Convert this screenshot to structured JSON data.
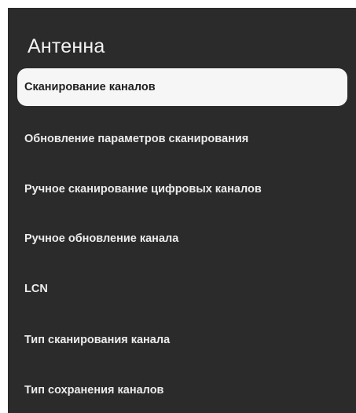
{
  "header": {
    "title": "Антенна"
  },
  "menu": {
    "items": [
      {
        "label": "Сканирование каналов",
        "selected": true
      },
      {
        "label": "Обновление параметров сканирования",
        "selected": false
      },
      {
        "label": "Ручное сканирование цифровых каналов",
        "selected": false
      },
      {
        "label": "Ручное обновление канала",
        "selected": false
      },
      {
        "label": "LCN",
        "selected": false
      },
      {
        "label": "Тип сканирования канала",
        "selected": false
      },
      {
        "label": "Тип сохранения каналов",
        "selected": false
      }
    ]
  },
  "colors": {
    "panel_background": "#2b2b2b",
    "selected_item_background": "#f6f6f6",
    "text_light": "#ececec",
    "text_dark": "#1f1f1f"
  }
}
